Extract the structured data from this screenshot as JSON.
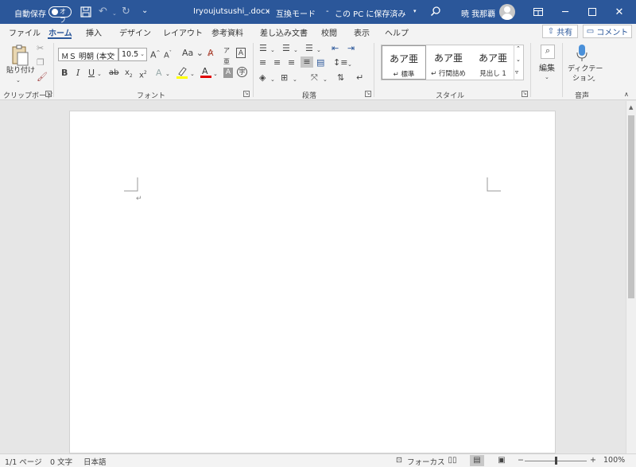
{
  "titlebar": {
    "autosave_label": "自動保存",
    "autosave_state": "オフ",
    "filename": "Iryoujutsushi_.docx",
    "mode": "互換モード",
    "save_state": "この PC に保存済み",
    "user_name": "暁 我那覇",
    "colors": {
      "bg": "#2b579a",
      "text": "#ffffff"
    }
  },
  "tabs": [
    {
      "label": "ファイル"
    },
    {
      "label": "ホーム",
      "active": true
    },
    {
      "label": "挿入"
    },
    {
      "label": "デザイン"
    },
    {
      "label": "レイアウト"
    },
    {
      "label": "参考資料"
    },
    {
      "label": "差し込み文書"
    },
    {
      "label": "校閲"
    },
    {
      "label": "表示"
    },
    {
      "label": "ヘルプ"
    }
  ],
  "share_label": "共有",
  "comment_label": "コメント",
  "ribbon": {
    "clipboard": {
      "label": "クリップボード",
      "paste_label": "貼り付け"
    },
    "font": {
      "label": "フォント",
      "font_name": "ＭＳ 明朝 (本文",
      "font_size": "10.5",
      "aa_label": "Aa"
    },
    "paragraph": {
      "label": "段落"
    },
    "styles": {
      "label": "スタイル",
      "items": [
        {
          "preview": "あア亜",
          "name": "標準",
          "selected": true
        },
        {
          "preview": "あア亜",
          "name": "行間詰め"
        },
        {
          "preview": "あア亜",
          "name": "見出し 1"
        }
      ]
    },
    "editing": {
      "label": "編集"
    },
    "voice": {
      "label": "音声",
      "dictation_line1": "ディクテー",
      "dictation_line2": "ション"
    }
  },
  "statusbar": {
    "page": "1/1 ページ",
    "words": "0 文字",
    "language": "日本語",
    "focus": "フォーカス",
    "zoom_minus": "−",
    "zoom_plus": "+",
    "zoom": "100%"
  },
  "document": {
    "paragraph_mark": "↵"
  }
}
